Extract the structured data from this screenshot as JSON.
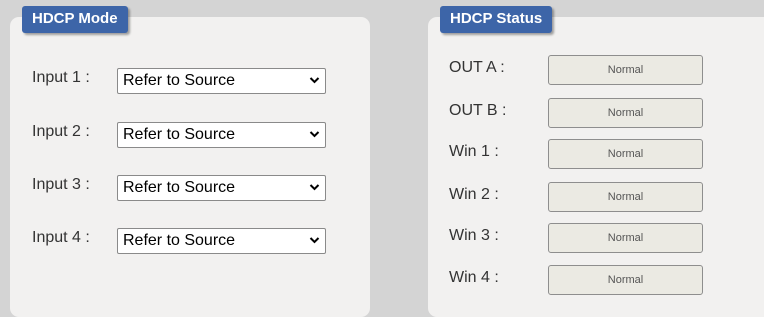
{
  "hdcp_mode": {
    "title": "HDCP Mode",
    "inputs": [
      {
        "label": "Input 1 :",
        "value": "Refer to Source"
      },
      {
        "label": "Input 2 :",
        "value": "Refer to Source"
      },
      {
        "label": "Input 3 :",
        "value": "Refer to Source"
      },
      {
        "label": "Input 4 :",
        "value": "Refer to Source"
      }
    ]
  },
  "hdcp_status": {
    "title": "HDCP Status",
    "outputs": [
      {
        "label": "OUT A :",
        "value": "Normal"
      },
      {
        "label": "OUT B :",
        "value": "Normal"
      },
      {
        "label": "Win 1 :",
        "value": "Normal"
      },
      {
        "label": "Win 2 :",
        "value": "Normal"
      },
      {
        "label": "Win 3 :",
        "value": "Normal"
      },
      {
        "label": "Win 4 :",
        "value": "Normal"
      }
    ]
  },
  "colors": {
    "tab_background": "#3d65a8",
    "panel_background": "#f2f1f0",
    "page_background": "#d4d4d4"
  }
}
